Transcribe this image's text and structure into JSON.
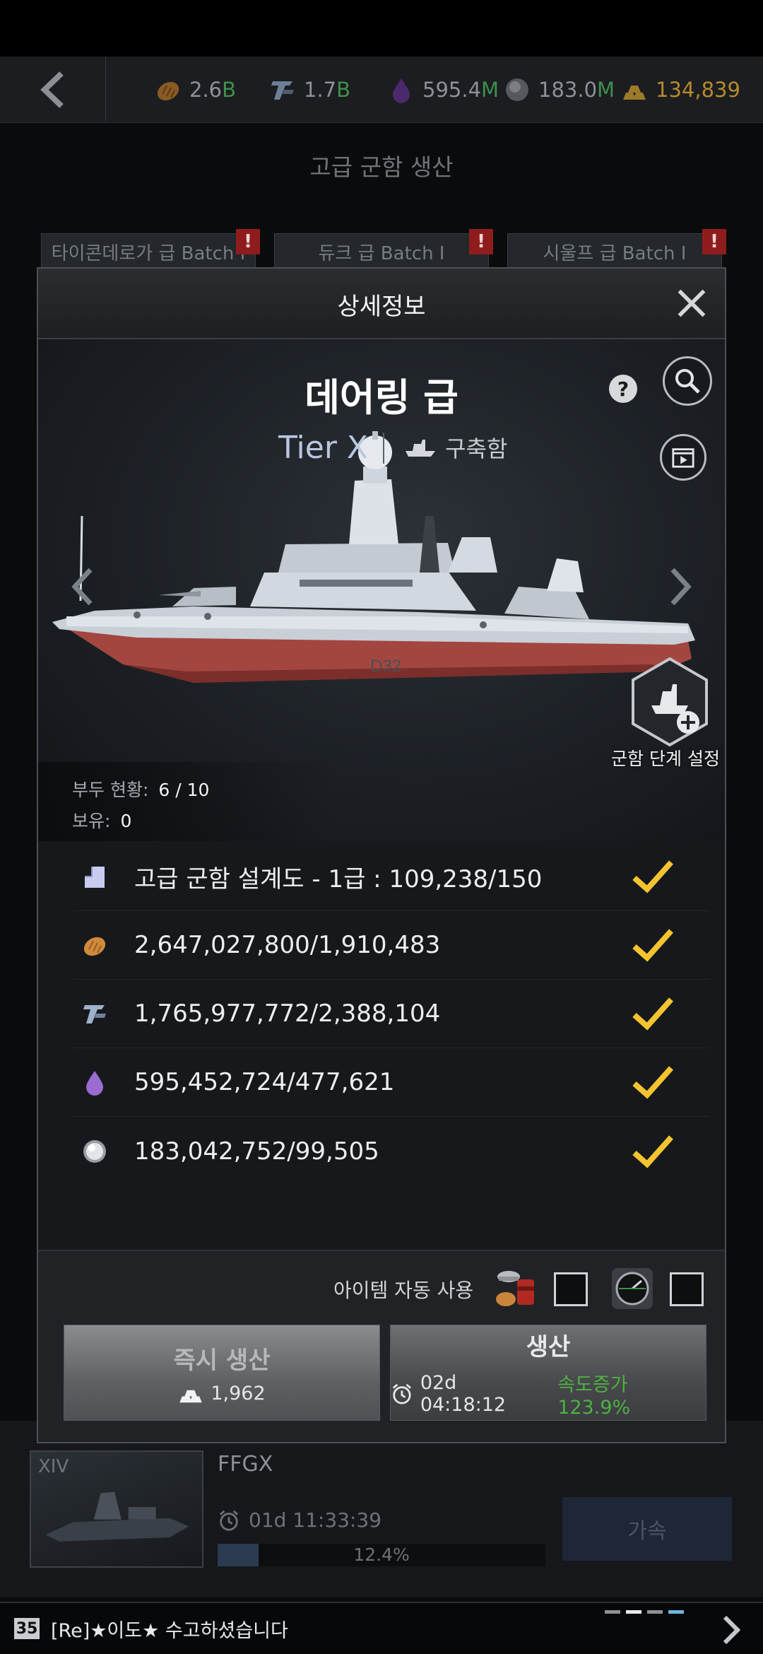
{
  "topbar": {
    "resources": [
      {
        "icon": "bread-icon",
        "value": "2.6",
        "unit": "B"
      },
      {
        "icon": "steel-icon",
        "value": "1.7",
        "unit": "B"
      },
      {
        "icon": "oil-icon",
        "value": "595.4",
        "unit": "M"
      },
      {
        "icon": "titanium-icon",
        "value": "183.0",
        "unit": "M"
      },
      {
        "icon": "gold-bars-icon",
        "value": "134,839",
        "unit": ""
      }
    ]
  },
  "background": {
    "page_title": "고급 군함 생산",
    "batch_tabs": [
      "타이콘데로가 급 Batch I",
      "듀크 급 Batch I",
      "시울프 급 Batch I"
    ],
    "alert_mark": "!"
  },
  "modal": {
    "title": "상세정보",
    "ship_name": "데어링 급",
    "tier": "Tier X",
    "ship_type": "구축함",
    "help_label": "?",
    "upgrade_label": "군함 단계 설정",
    "status": {
      "dock_label": "부두 현황:",
      "dock_value": "6 / 10",
      "owned_label": "보유:",
      "owned_value": "0"
    },
    "requirements": [
      {
        "icon": "blueprint-icon",
        "text": "고급 군함 설계도 - 1급 : 109,238/150",
        "met": true
      },
      {
        "icon": "bread-icon",
        "text": "2,647,027,800/1,910,483",
        "met": true
      },
      {
        "icon": "steel-icon",
        "text": "1,765,977,772/2,388,104",
        "met": true
      },
      {
        "icon": "oil-icon",
        "text": "595,452,724/477,621",
        "met": true
      },
      {
        "icon": "titanium-icon",
        "text": "183,042,752/99,505",
        "met": true
      }
    ],
    "auto_use_label": "아이템 자동 사용",
    "instant_button": {
      "label": "즉시 생산",
      "cost": "1,962"
    },
    "produce_button": {
      "label": "생산",
      "time": "02d 04:18:12",
      "speed": "속도증가 123.9%"
    }
  },
  "queue": {
    "tier": "XIV",
    "name": "FFGX",
    "time": "01d 11:33:39",
    "progress_label": "12.4%",
    "progress": 0.124,
    "speedup_label": "가속"
  },
  "chat": {
    "level": "35",
    "message": "[Re]★이도★  수고하셨습니다"
  },
  "colors": {
    "accent_check": "#f4c430",
    "speed_green": "#4fb043",
    "resource_unit_green": "#3f8f4d",
    "alert_red": "#8f1c1c"
  }
}
